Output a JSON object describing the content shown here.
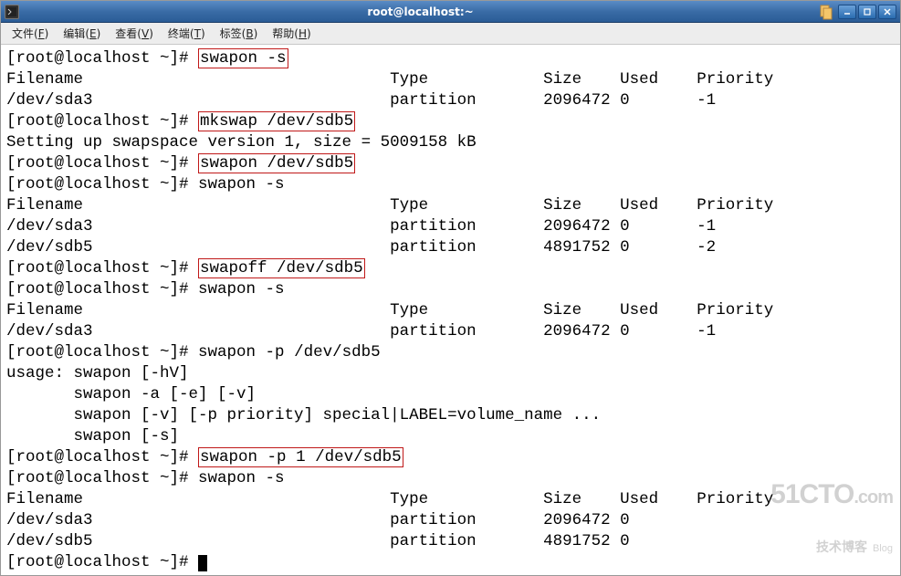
{
  "window": {
    "title": "root@localhost:~"
  },
  "menubar": {
    "items": [
      {
        "label": "文件",
        "key": "F"
      },
      {
        "label": "编辑",
        "key": "E"
      },
      {
        "label": "查看",
        "key": "V"
      },
      {
        "label": "终端",
        "key": "T"
      },
      {
        "label": "标签",
        "key": "B"
      },
      {
        "label": "帮助",
        "key": "H"
      }
    ]
  },
  "term": {
    "prompt": "[root@localhost ~]# ",
    "cmd1": "swapon -s",
    "hdr": {
      "c0": "Filename",
      "c1": "Type",
      "c2": "Size",
      "c3": "Used",
      "c4": "Priority"
    },
    "row_sda3": {
      "c0": "/dev/sda3",
      "c1": "partition",
      "c2": "2096472",
      "c3": "0",
      "c4": "-1"
    },
    "cmd2": "mkswap /dev/sdb5",
    "mkswap_out": "Setting up swapspace version 1, size = 5009158 kB",
    "cmd3": "swapon /dev/sdb5",
    "cmd4": "swapon -s",
    "row_sdb5_a": {
      "c0": "/dev/sdb5",
      "c1": "partition",
      "c2": "4891752",
      "c3": "0",
      "c4": "-2"
    },
    "cmd5": "swapoff /dev/sdb5",
    "cmd6": "swapon -s",
    "cmd7": "swapon -p /dev/sdb5",
    "usage": {
      "l1": "usage: swapon [-hV]",
      "l2": "       swapon -a [-e] [-v]",
      "l3": "       swapon [-v] [-p priority] special|LABEL=volume_name ...",
      "l4": "       swapon [-s]"
    },
    "cmd8": "swapon -p 1 /dev/sdb5",
    "cmd9": "swapon -s",
    "row_sda3_b": {
      "c0": "/dev/sda3",
      "c1": "partition",
      "c2": "2096472",
      "c3": "0"
    },
    "row_sdb5_b": {
      "c0": "/dev/sdb5",
      "c1": "partition",
      "c2": "4891752",
      "c3": "0"
    }
  },
  "watermark": {
    "brand": "51CTO",
    "suffix": ".com",
    "sub": "技术博客",
    "blog": "Blog"
  }
}
